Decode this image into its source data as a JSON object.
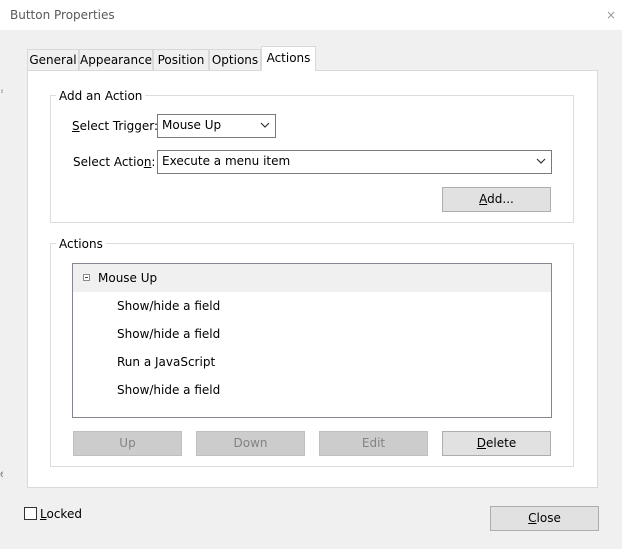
{
  "window": {
    "title": "Button Properties",
    "close_glyph": "×",
    "left_edge_marks": [
      "=",
      "e"
    ]
  },
  "tabs": [
    {
      "label": "General",
      "active": false
    },
    {
      "label": "Appearance",
      "active": false
    },
    {
      "label": "Position",
      "active": false
    },
    {
      "label": "Options",
      "active": false
    },
    {
      "label": "Actions",
      "active": true
    }
  ],
  "add_action": {
    "group_label": "Add an Action",
    "trigger_label_mnemonic": "S",
    "trigger_label_rest": "elect Trigger:",
    "trigger_value": "Mouse Up",
    "action_label_start": "Select Actio",
    "action_label_mnemonic": "n",
    "action_label_end": ":",
    "action_value": "Execute a menu item",
    "add_button_mnemonic": "A",
    "add_button_rest": "dd..."
  },
  "actions": {
    "group_label": "Actions",
    "tree_root": "Mouse Up",
    "tree_children": [
      "Show/hide a field",
      "Show/hide a field",
      "Run a JavaScript",
      "Show/hide a field"
    ],
    "buttons": {
      "up": "Up",
      "down": "Down",
      "edit": "Edit",
      "delete_mnemonic": "D",
      "delete_rest": "elete"
    }
  },
  "footer": {
    "locked_mnemonic": "L",
    "locked_rest": "ocked",
    "locked_checked": false,
    "close_mnemonic": "C",
    "close_rest": "lose"
  },
  "icons": {
    "dropdown": "chevron-down-icon",
    "collapse": "minus-box-icon",
    "checkbox": "checkbox-icon"
  }
}
